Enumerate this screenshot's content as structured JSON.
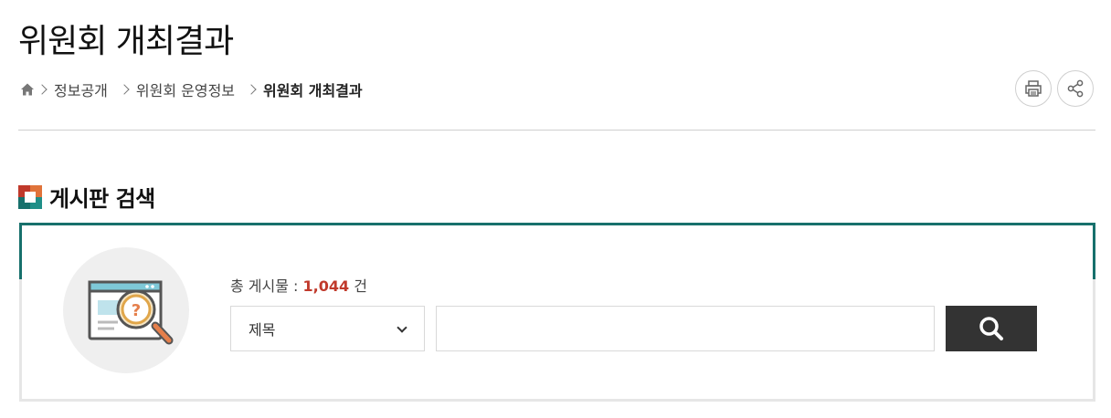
{
  "page": {
    "title": "위원회 개최결과"
  },
  "breadcrumb": {
    "home_icon": "home-icon",
    "items": [
      "정보공개",
      "위원회 운영정보",
      "위원회 개최결과"
    ]
  },
  "utilities": {
    "print_icon": "print-icon",
    "share_icon": "share-icon"
  },
  "section": {
    "title": "게시판 검색"
  },
  "search": {
    "total_label": "총 게시물 : ",
    "total_count": "1,044",
    "total_unit": " 건",
    "field_select": {
      "selected": "제목"
    },
    "keyword": {
      "value": "",
      "placeholder": ""
    },
    "button_icon": "search-icon"
  },
  "colors": {
    "accent_teal": "#17706c",
    "count_red": "#c0392b",
    "search_button": "#333333"
  }
}
